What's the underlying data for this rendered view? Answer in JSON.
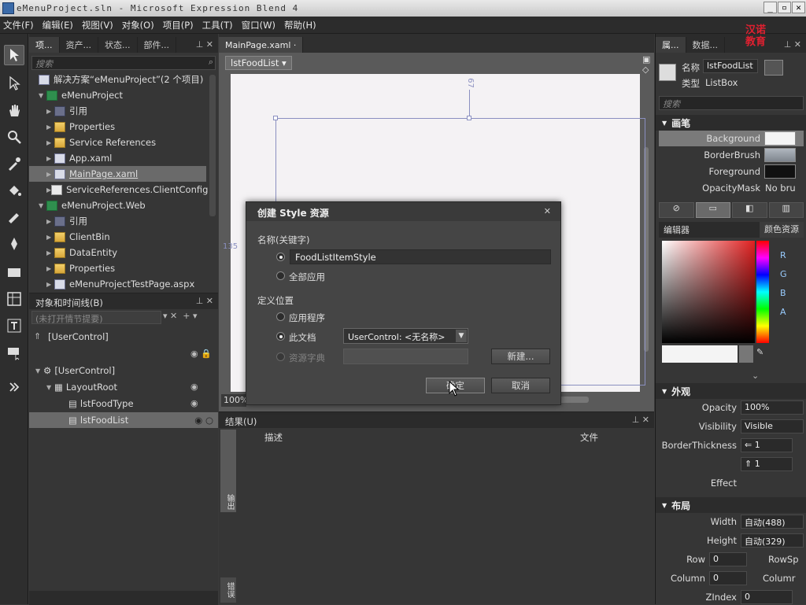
{
  "window": {
    "title": "eMenuProject.sln - Microsoft Expression Blend 4"
  },
  "menu": [
    "文件(F)",
    "编辑(E)",
    "视图(V)",
    "对象(O)",
    "项目(P)",
    "工具(T)",
    "窗口(W)",
    "帮助(H)"
  ],
  "left_tabs": [
    "项...",
    "资产...",
    "状态...",
    "部件..."
  ],
  "search_placeholder": "搜索",
  "project_tree": [
    {
      "label": "解决方案“eMenuProject”(2 个项目)",
      "icon": "solution-icon",
      "level": 0
    },
    {
      "label": "eMenuProject",
      "icon": "project-icon",
      "level": 1
    },
    {
      "label": "引用",
      "icon": "references-icon",
      "level": 2
    },
    {
      "label": "Properties",
      "icon": "folder-icon",
      "level": 2
    },
    {
      "label": "Service References",
      "icon": "folder-icon",
      "level": 2
    },
    {
      "label": "App.xaml",
      "icon": "xaml-file-icon",
      "level": 2
    },
    {
      "label": "MainPage.xaml",
      "icon": "xaml-file-icon",
      "level": 2,
      "selected": true
    },
    {
      "label": "ServiceReferences.ClientConfig",
      "icon": "file-icon",
      "level": 2
    },
    {
      "label": "eMenuProject.Web",
      "icon": "project-icon",
      "level": 1
    },
    {
      "label": "引用",
      "icon": "references-icon",
      "level": 2
    },
    {
      "label": "ClientBin",
      "icon": "folder-icon",
      "level": 2
    },
    {
      "label": "DataEntity",
      "icon": "folder-icon",
      "level": 2
    },
    {
      "label": "Properties",
      "icon": "folder-icon",
      "level": 2
    },
    {
      "label": "eMenuProjectTestPage.aspx",
      "icon": "xaml-file-icon",
      "level": 2
    }
  ],
  "objects_panel": {
    "title": "对象和时间线(B)",
    "storyboard": "(未打开情节提要)",
    "scope": "[UserControl]",
    "tree": [
      {
        "label": "[UserControl]",
        "level": 0
      },
      {
        "label": "LayoutRoot",
        "level": 1
      },
      {
        "label": "lstFoodType",
        "level": 2
      },
      {
        "label": "lstFoodList",
        "level": 2,
        "selected": true
      }
    ]
  },
  "document": {
    "tab": "MainPage.xaml",
    "breadcrumb": "lstFoodList",
    "zoom": "100%",
    "ruler_top": "67",
    "ruler_left": "135"
  },
  "results": {
    "title": "结果(U)",
    "columns": [
      "描述",
      "文件"
    ],
    "side_labels": [
      "输出",
      "错误"
    ]
  },
  "right_tabs": [
    "属...",
    "数据..."
  ],
  "properties": {
    "name_label": "名称",
    "name_value": "lstFoodList",
    "type_label": "类型",
    "type_value": "ListBox",
    "search_placeholder": "搜索",
    "brushes": {
      "title": "画笔",
      "items": [
        {
          "label": "Background",
          "color": "#f4f4f4",
          "text": ""
        },
        {
          "label": "BorderBrush",
          "color": "#9aa0a8",
          "text": ""
        },
        {
          "label": "Foreground",
          "color": "#111111",
          "text": ""
        },
        {
          "label": "OpacityMask",
          "color": "",
          "text": "No bru"
        }
      ]
    },
    "editor_tabs": [
      "编辑器",
      "颜色资源"
    ],
    "color_channels": [
      "R",
      "G",
      "B",
      "A"
    ],
    "appearance": {
      "title": "外观",
      "opacity_label": "Opacity",
      "opacity": "100%",
      "visibility_label": "Visibility",
      "visibility": "Visible",
      "border_label": "BorderThickness",
      "border_left": "1",
      "border_top": "1",
      "effect_label": "Effect"
    },
    "layout": {
      "title": "布局",
      "width_label": "Width",
      "width": "自动(488)",
      "height_label": "Height",
      "height": "自动(329)",
      "row_label": "Row",
      "row": "0",
      "rowspan_label": "RowSp",
      "column_label": "Column",
      "column": "0",
      "colspan_label": "Columr",
      "zindex_label": "ZIndex",
      "zindex": "0"
    }
  },
  "dialog": {
    "title": "创建 Style 资源",
    "name_section": "名称(关键字)",
    "name_value": "FoodListItemStyle",
    "apply_all": "全部应用",
    "define_section": "定义位置",
    "option_app": "应用程序",
    "option_doc": "此文档",
    "doc_value": "UserControl: <无名称>",
    "option_dict": "资源字典",
    "new_button": "新建...",
    "ok_button": "确定",
    "cancel_button": "取消"
  },
  "watermark": "汉诺教育",
  "colors": {
    "accent": "#6a6a6a",
    "dialog_bg": "#454545",
    "panel_bg": "#363636"
  }
}
